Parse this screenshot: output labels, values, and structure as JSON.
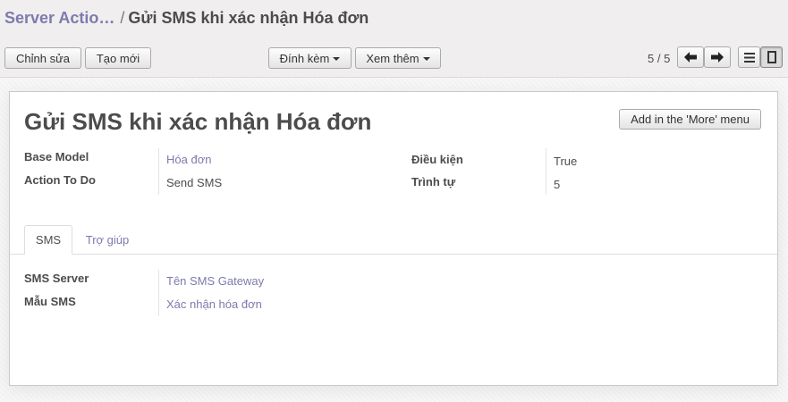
{
  "breadcrumb": {
    "parent": "Server Actio…",
    "separator": "/",
    "current": "Gửi SMS khi xác nhận Hóa đơn"
  },
  "toolbar": {
    "edit_label": "Chỉnh sửa",
    "create_label": "Tạo mới",
    "attach_label": "Đính kèm",
    "more_label": "Xem thêm"
  },
  "pager": {
    "value": "5 / 5"
  },
  "record": {
    "title": "Gửi SMS khi xác nhận Hóa đơn",
    "add_more_menu_label": "Add in the 'More' menu",
    "fields": {
      "base_model": {
        "label": "Base Model",
        "value": "Hóa đơn"
      },
      "action_to_do": {
        "label": "Action To Do",
        "value": "Send SMS"
      },
      "condition": {
        "label": "Điều kiện",
        "value": "True"
      },
      "sequence": {
        "label": "Trình tự",
        "value": "5"
      }
    }
  },
  "tabs": [
    {
      "label": "SMS",
      "active": true
    },
    {
      "label": "Trợ giúp",
      "active": false
    }
  ],
  "sms_tab": {
    "sms_server": {
      "label": "SMS Server",
      "value": "Tên SMS Gateway"
    },
    "sms_template": {
      "label": "Mẫu SMS",
      "value": "Xác nhận hóa đơn"
    }
  },
  "colors": {
    "link": "#7c7bad",
    "text": "#4c4c4c",
    "control_panel_bg": "#f0eeee"
  },
  "icons": {
    "prev": "arrow-left-icon",
    "next": "arrow-right-icon",
    "list_view": "list-view-icon",
    "form_view": "form-view-icon",
    "dropdown": "caret-down-icon"
  }
}
